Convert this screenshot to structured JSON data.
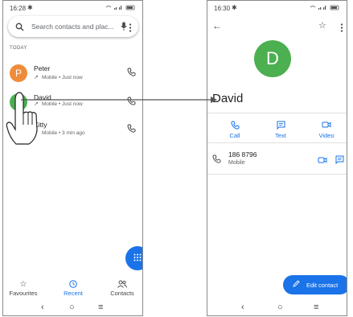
{
  "left_screen": {
    "status_time": "16:28",
    "search": {
      "placeholder": "Search contacts and plac..."
    },
    "section_label": "TODAY",
    "calls": [
      {
        "initial": "P",
        "name": "Peter",
        "detail": "Mobile • Just now",
        "avatar_color": "#ef8c3a",
        "direction": "outgoing"
      },
      {
        "initial": "",
        "name": "David",
        "detail": "Mobile • Just now",
        "avatar_color": "#4caf50",
        "direction": "outgoing"
      },
      {
        "initial": "",
        "name": "Kitty",
        "detail": "Mobile • 3 min ago",
        "avatar_color": "#ffffff",
        "direction": "incoming"
      }
    ],
    "bottom_nav": [
      {
        "label": "Favourites"
      },
      {
        "label": "Recent",
        "active": true
      },
      {
        "label": "Contacts"
      }
    ]
  },
  "right_screen": {
    "status_time": "16:30",
    "avatar_initial": "D",
    "contact_name": "David",
    "actions": [
      {
        "label": "Call"
      },
      {
        "label": "Text"
      },
      {
        "label": "Video"
      }
    ],
    "phone_number": "186 8796",
    "phone_type": "Mobile",
    "edit_button": "Edit contact"
  },
  "colors": {
    "accent": "#1a73e8",
    "avatar_green": "#4caf50",
    "avatar_orange": "#ef8c3a"
  },
  "icons": [
    "gear-icon",
    "search-icon",
    "mic-icon",
    "more-vert-icon",
    "phone-icon",
    "back-arrow-icon",
    "star-icon",
    "message-icon",
    "video-icon",
    "dialpad-icon",
    "clock-icon",
    "people-icon",
    "edit-icon",
    "tap-hand-icon",
    "arrow-icon"
  ]
}
